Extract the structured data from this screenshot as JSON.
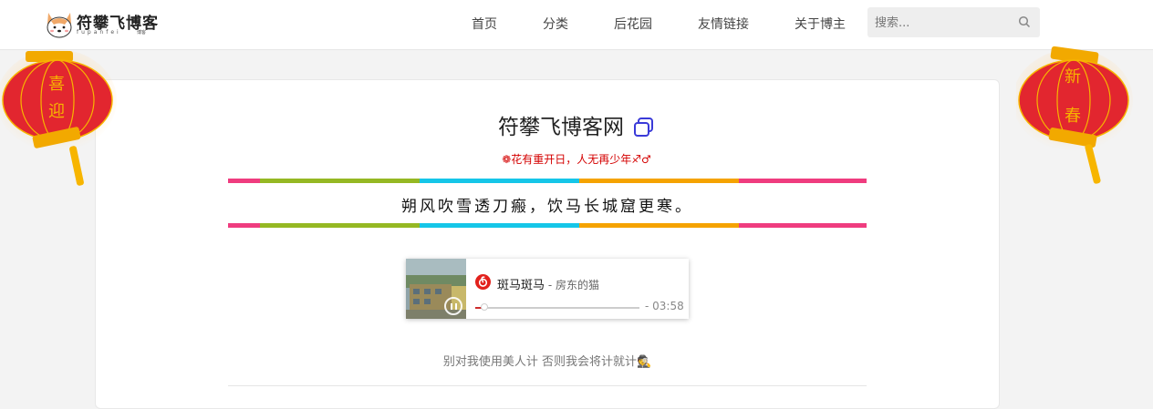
{
  "header": {
    "logo_title": "符攀飞博客",
    "logo_sub": "fupanfei",
    "logo_tag": "博客",
    "nav": [
      {
        "label": "首页"
      },
      {
        "label": "分类"
      },
      {
        "label": "后花园"
      },
      {
        "label": "友情链接"
      },
      {
        "label": "关于博主"
      }
    ],
    "search": {
      "placeholder": "搜索..."
    }
  },
  "main": {
    "site_title": "符攀飞博客网",
    "motto": "❁花有重开日，人无再少年♐♂",
    "poem": "朔风吹雪透刀瘢，饮马长城窟更寒。",
    "stripe_colors": [
      "#ef3c7f",
      "#95b823",
      "#15c6e8",
      "#f5a300",
      "#ef3c7f"
    ],
    "stripe_widths": [
      5,
      25,
      25,
      25,
      20
    ],
    "quote": "别对我使用美人计 否则我会将计就计🕵"
  },
  "player": {
    "title": "斑马斑马",
    "artist": " - 房东的猫",
    "time": "- 03:58",
    "progress": 0.04,
    "accent": "#cd2d2d"
  },
  "lanterns": {
    "left": [
      "喜",
      "迎"
    ],
    "right": [
      "新",
      "春"
    ]
  }
}
